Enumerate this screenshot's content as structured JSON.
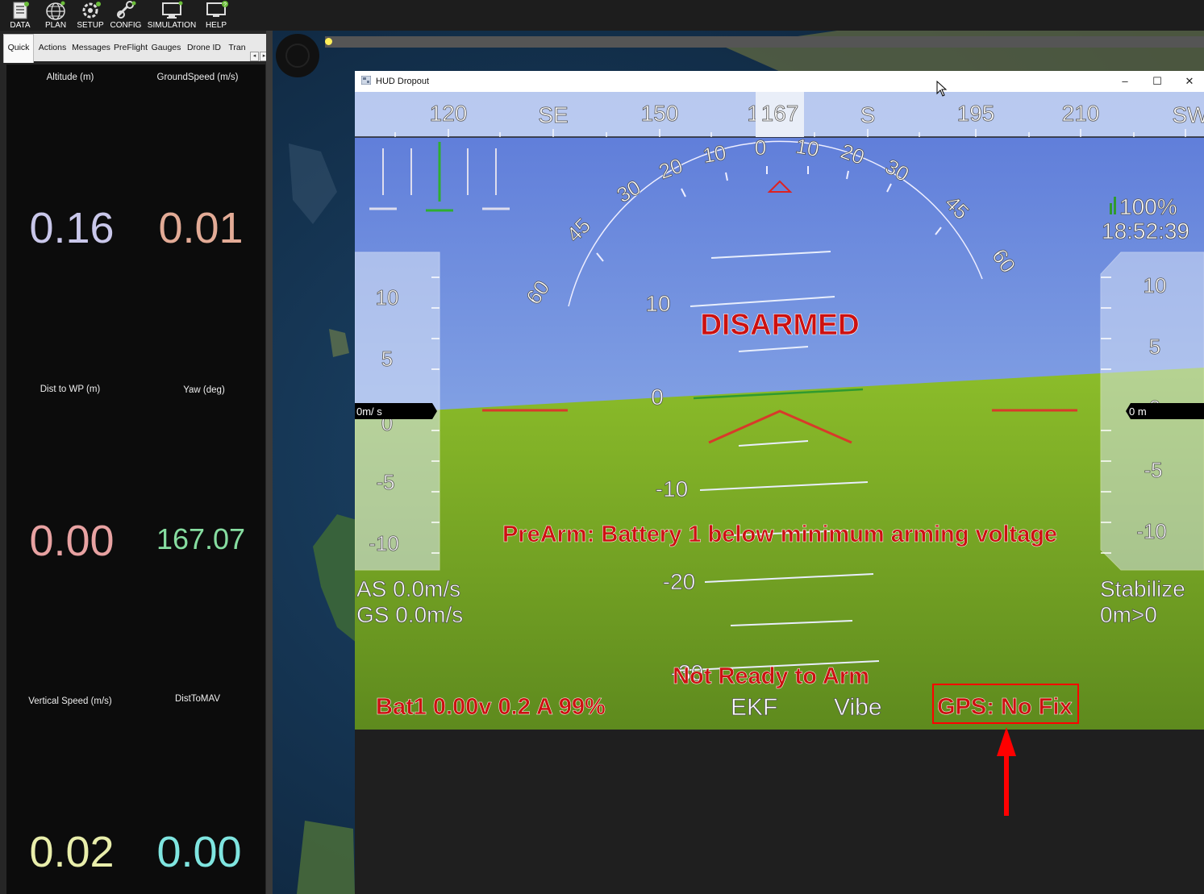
{
  "toolbar": {
    "items": [
      {
        "label": "DATA",
        "icon": "data-icon"
      },
      {
        "label": "PLAN",
        "icon": "globe-icon"
      },
      {
        "label": "SETUP",
        "icon": "setup-icon"
      },
      {
        "label": "CONFIG",
        "icon": "config-icon"
      },
      {
        "label": "SIMULATION",
        "icon": "simulation-icon"
      },
      {
        "label": "HELP",
        "icon": "help-icon"
      }
    ]
  },
  "tabs": [
    "Quick",
    "Actions",
    "Messages",
    "PreFlight",
    "Gauges",
    "Drone ID",
    "Tran"
  ],
  "tab_active": "Quick",
  "tab_arrows": {
    "left": "◂",
    "right": "▸"
  },
  "quick": [
    {
      "label": "Altitude (m)",
      "value": "0.16",
      "color": "#c9c7ea"
    },
    {
      "label": "GroundSpeed (m/s)",
      "value": "0.01",
      "color": "#e3ab96"
    },
    {
      "label": "Dist to WP (m)",
      "value": "0.00",
      "color": "#e8a2a2"
    },
    {
      "label": "Yaw (deg)",
      "value": "167.07",
      "color": "#86dda0"
    },
    {
      "label": "Vertical Speed (m/s)",
      "value": "0.02",
      "color": "#e9eeab"
    },
    {
      "label": "DistToMAV",
      "value": "0.00",
      "color": "#7fe5e0"
    }
  ],
  "hud_window": {
    "title": "HUD Dropout",
    "controls": {
      "minimize": "–",
      "maximize": "☐",
      "close": "✕"
    }
  },
  "hud": {
    "heading_ticks": [
      "120",
      "SE",
      "150",
      "1",
      "S",
      "195",
      "210",
      "SW"
    ],
    "heading_value": "167",
    "roll_labels": [
      "60",
      "45",
      "30",
      "20",
      "10",
      "0",
      "10",
      "20",
      "30",
      "45",
      "60"
    ],
    "pitch_labels": [
      "10",
      "0",
      "-10",
      "-20",
      "-30"
    ],
    "speed_tape_labels": [
      "10",
      "5",
      "0",
      "-5",
      "-10"
    ],
    "alt_tape_labels": [
      "10",
      "5",
      "0",
      "-5",
      "-10"
    ],
    "speed_readout": "0m/ s",
    "alt_readout": "0  m",
    "battery_pct": "100%",
    "clock": "18:52:39",
    "status_armed": "DISARMED",
    "message": "PreArm: Battery 1 below minimum arming voltage",
    "airspeed": "AS 0.0m/s",
    "groundspeed": "GS 0.0m/s",
    "mode": "Stabilize",
    "wp_dist": "0m>0",
    "not_ready": "Not Ready to Arm",
    "battery": "Bat1 0.00v 0.2 A 99%",
    "ekf": "EKF",
    "vibe": "Vibe",
    "gps": "GPS: No Fix"
  },
  "colors": {
    "sky_top": "#5b79d8",
    "sky_bottom": "#a6c6ef",
    "ground_top": "#8cbd2a",
    "ground_bottom": "#5e8a1e",
    "warning_red": "#cc1111",
    "annotation_red": "#ff0000"
  }
}
